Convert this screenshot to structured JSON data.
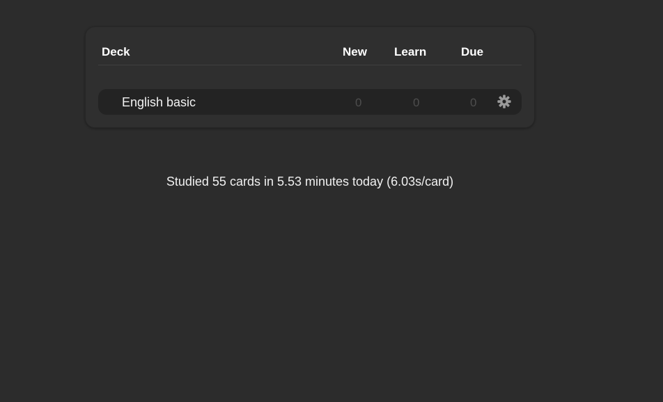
{
  "table": {
    "headers": {
      "deck": "Deck",
      "new": "New",
      "learn": "Learn",
      "due": "Due"
    },
    "decks": [
      {
        "name": "English basic",
        "new": "0",
        "learn": "0",
        "due": "0",
        "options_icon": "gear-icon"
      }
    ]
  },
  "stats": {
    "studied_text": "Studied 55 cards in 5.53 minutes today (6.03s/card)"
  },
  "colors": {
    "background": "#2c2c2c",
    "panel": "#2f2f2f",
    "row": "#232323",
    "zero_count": "#4e4e4e",
    "gear": "#9a9a9a"
  }
}
